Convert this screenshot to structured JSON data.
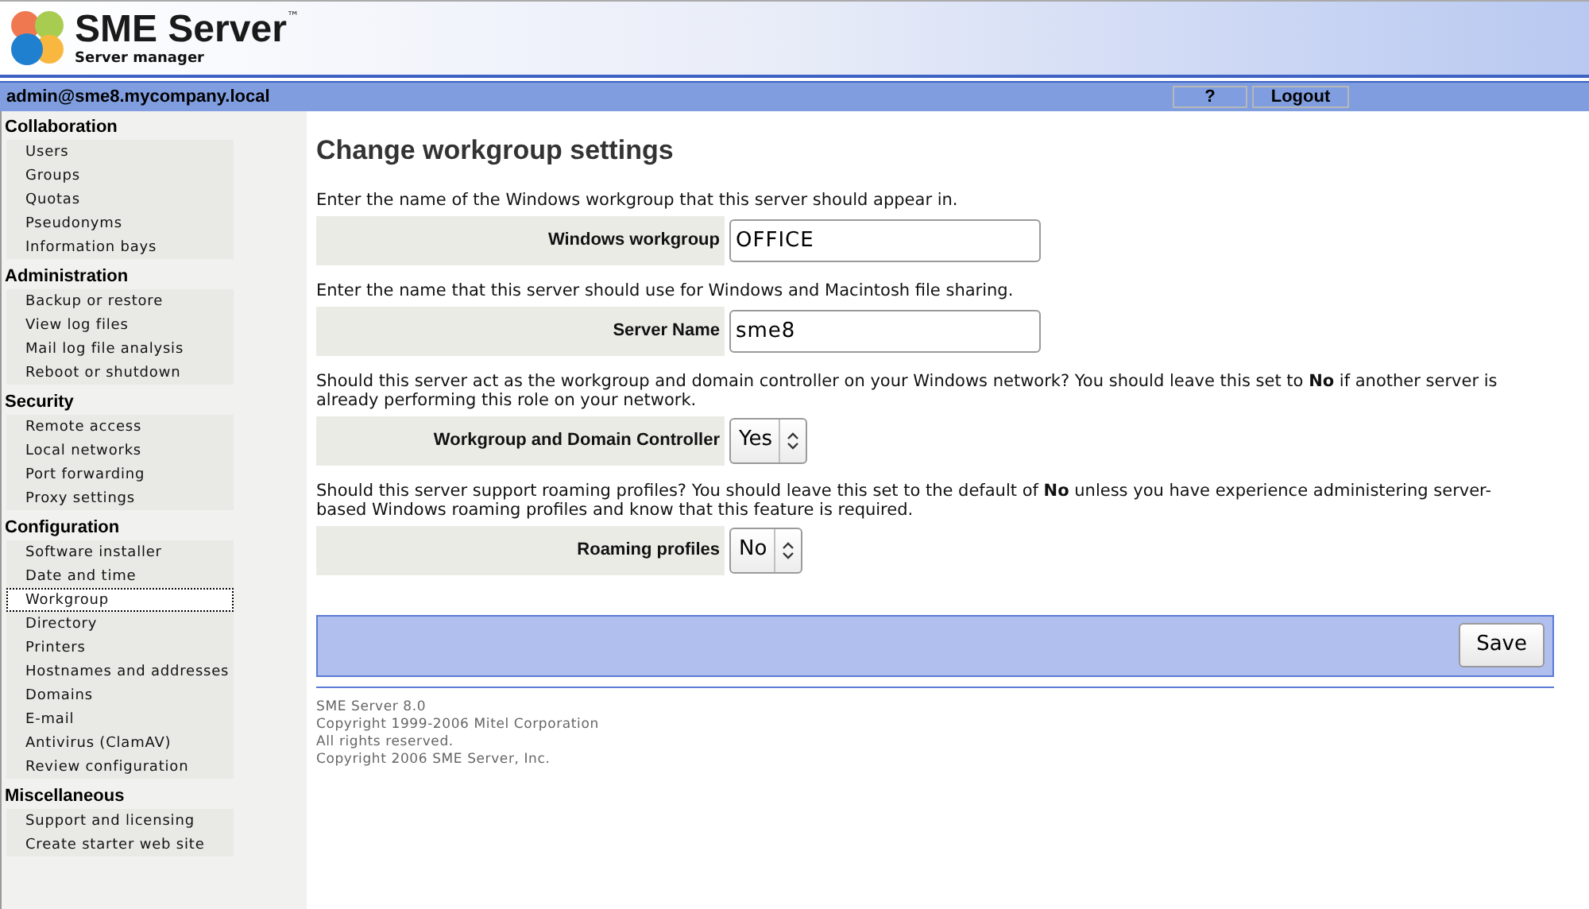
{
  "header": {
    "logo_title": "SME Server",
    "logo_tm": "™",
    "logo_subtitle": "Server manager"
  },
  "user_bar": {
    "user": "admin@sme8.mycompany.local",
    "buttons": [
      "?",
      "Logout"
    ]
  },
  "sidebar": {
    "sections": [
      {
        "title": "Collaboration",
        "items": [
          {
            "label": "Users",
            "selected": false
          },
          {
            "label": "Groups",
            "selected": false
          },
          {
            "label": "Quotas",
            "selected": false
          },
          {
            "label": "Pseudonyms",
            "selected": false
          },
          {
            "label": "Information bays",
            "selected": false
          }
        ]
      },
      {
        "title": "Administration",
        "items": [
          {
            "label": "Backup or restore",
            "selected": false
          },
          {
            "label": "View log files",
            "selected": false
          },
          {
            "label": "Mail log file analysis",
            "selected": false
          },
          {
            "label": "Reboot or shutdown",
            "selected": false
          }
        ]
      },
      {
        "title": "Security",
        "items": [
          {
            "label": "Remote access",
            "selected": false
          },
          {
            "label": "Local networks",
            "selected": false
          },
          {
            "label": "Port forwarding",
            "selected": false
          },
          {
            "label": "Proxy settings",
            "selected": false
          }
        ]
      },
      {
        "title": "Configuration",
        "items": [
          {
            "label": "Software installer",
            "selected": false
          },
          {
            "label": "Date and time",
            "selected": false
          },
          {
            "label": "Workgroup",
            "selected": true
          },
          {
            "label": "Directory",
            "selected": false
          },
          {
            "label": "Printers",
            "selected": false
          },
          {
            "label": "Hostnames and addresses",
            "selected": false
          },
          {
            "label": "Domains",
            "selected": false
          },
          {
            "label": "E-mail",
            "selected": false
          },
          {
            "label": "Antivirus (ClamAV)",
            "selected": false
          },
          {
            "label": "Review configuration",
            "selected": false
          }
        ]
      },
      {
        "title": "Miscellaneous",
        "items": [
          {
            "label": "Support and licensing",
            "selected": false
          },
          {
            "label": "Create starter web site",
            "selected": false
          }
        ]
      }
    ]
  },
  "page": {
    "title": "Change workgroup settings",
    "fields": [
      {
        "kind": "text",
        "description": "Enter the name of the Windows workgroup that this server should appear in.",
        "label": "Windows workgroup",
        "value": "OFFICE"
      },
      {
        "kind": "text",
        "description": "Enter the name that this server should use for Windows and Macintosh file sharing.",
        "label": "Server Name",
        "value": "sme8"
      },
      {
        "kind": "select",
        "description": "Should this server act as the workgroup and domain controller on your Windows network? You should leave this set to **No** if another server is already performing this role on your network.",
        "label": "Workgroup and Domain Controller",
        "value": "Yes"
      },
      {
        "kind": "select",
        "description": "Should this server support roaming profiles? You should leave this set to the default of **No** unless you have experience administering server-based Windows roaming profiles and know that this feature is required.",
        "label": "Roaming profiles",
        "value": "No"
      }
    ],
    "save_button": "Save"
  },
  "footer": [
    "SME Server 8.0",
    "Copyright 1999-2006 Mitel Corporation",
    "All rights reserved.",
    "Copyright 2006 SME Server, Inc."
  ]
}
